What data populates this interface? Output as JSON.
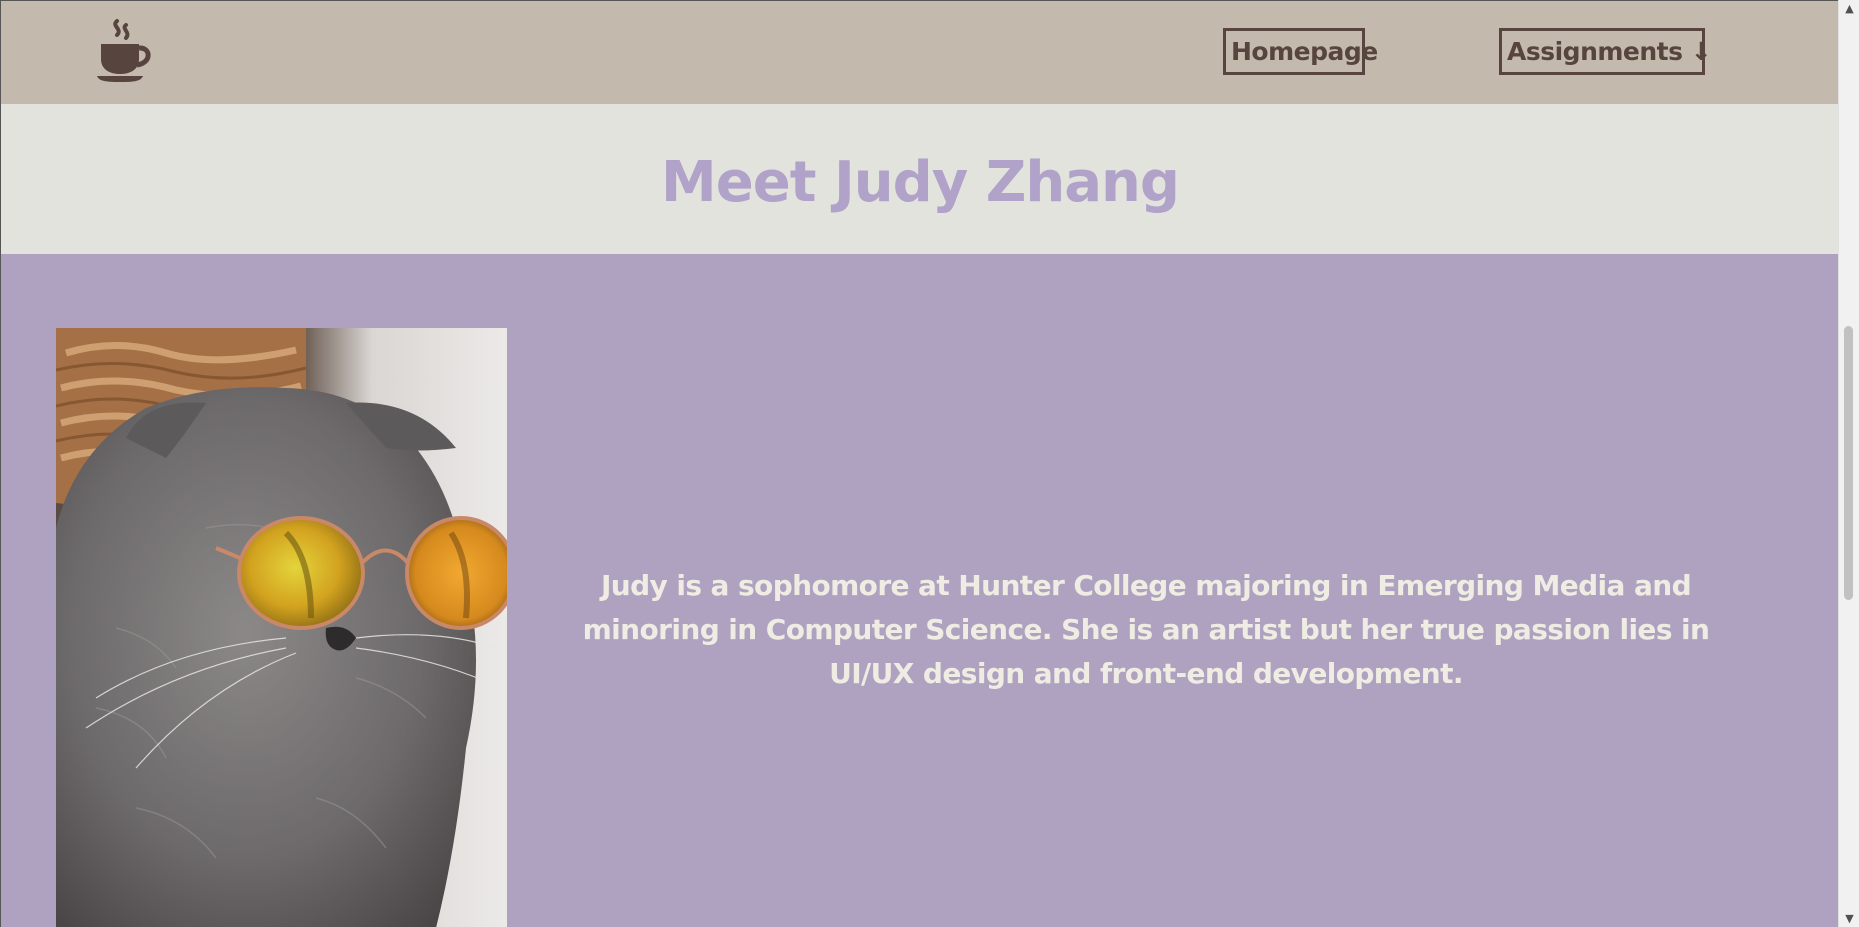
{
  "colors": {
    "nav_background": "#c3b9ad",
    "nav_accent": "#57443f",
    "hero_background": "#e3e3dd",
    "title_color": "#b0a2c8",
    "about_background": "#aea2c0",
    "bio_text_color": "#efece3"
  },
  "navbar": {
    "logo_icon": "coffee-cup-icon",
    "links": [
      {
        "label": "Homepage"
      },
      {
        "label": "Assignments ↓"
      }
    ]
  },
  "hero": {
    "title": "Meet Judy Zhang"
  },
  "about": {
    "photo_icon": "cat-with-sunglasses-photo",
    "bio": "Judy is a sophomore at Hunter College majoring in Emerging Media and minoring in Computer Science. She is an artist but her true passion lies in UI/UX design and front-end development."
  },
  "scrollbar": {
    "up_icon": "scroll-up-arrow-icon",
    "down_icon": "scroll-down-arrow-icon"
  }
}
